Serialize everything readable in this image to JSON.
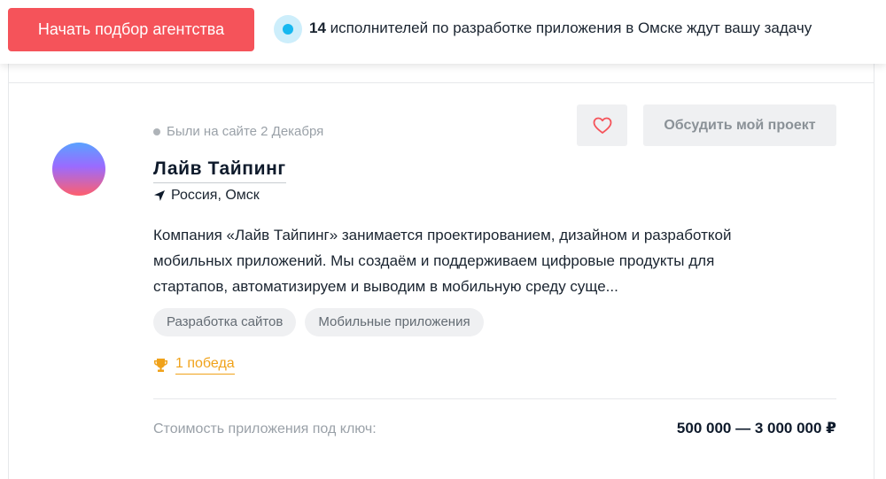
{
  "topbar": {
    "start_button_label": "Начать подбор агентства",
    "agencies_count": "14",
    "agencies_text": " исполнителей по разработке приложения в Омске ждут вашу задачу"
  },
  "agency": {
    "last_seen": "Были на сайте 2 Декабря",
    "name": "Лайв Тайпинг",
    "location": "Россия, Омск",
    "description": "Компания «Лайв Тайпинг» занимается проектированием, дизайном и разработкой мобильных приложений. Мы создаём и поддерживаем цифровые продукты для стартапов, автоматизируем и выводим в мобильную среду суще...",
    "tags": [
      "Разработка сайтов",
      "Мобильные приложения"
    ],
    "wins": "1 победа",
    "discuss_button_label": "Обсудить мой проект",
    "price_label": "Стоимость приложения под ключ:",
    "price_value": "500 000 — 3 000 000 ₽"
  },
  "icons": {
    "status_dot": "status-dot-icon",
    "location": "location-arrow-icon",
    "trophy": "trophy-icon",
    "favorite": "heart-icon"
  },
  "colors": {
    "accent_red": "#f5535a",
    "live_blue": "#16b8f0",
    "trophy_orange": "#f0a21a"
  }
}
